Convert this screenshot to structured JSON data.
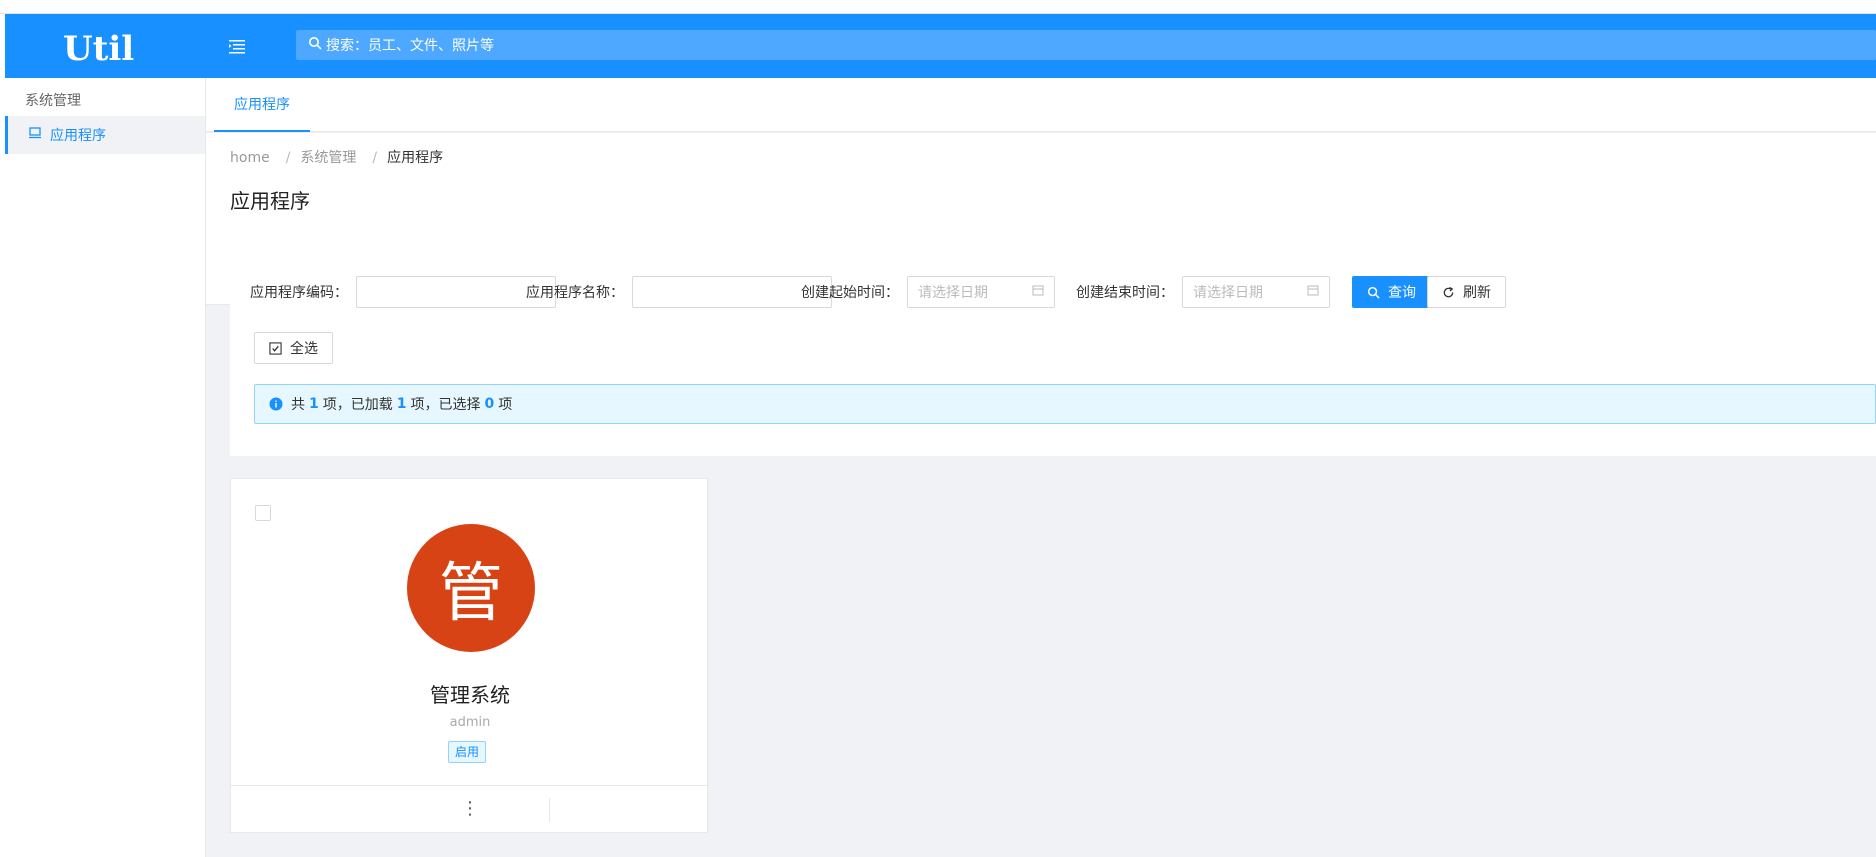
{
  "header": {
    "logo_text": "Util",
    "search_label": "搜索：员工、文件、照片等"
  },
  "sidebar": {
    "group_label": "系统管理",
    "items": [
      {
        "label": "应用程序",
        "icon": "laptop-icon"
      }
    ]
  },
  "tabs": [
    {
      "label": "应用程序"
    }
  ],
  "breadcrumb": [
    "home",
    "系统管理",
    "应用程序"
  ],
  "page_title": "应用程序",
  "filter": {
    "code_label": "应用程序编码：",
    "name_label": "应用程序名称：",
    "start_label": "创建起始时间：",
    "end_label": "创建结束时间：",
    "date_placeholder": "请选择日期",
    "query_label": "查询",
    "refresh_label": "刷新",
    "select_all_label": "全选"
  },
  "summary": {
    "prefix": "共",
    "total": "1",
    "mid1": "项，已加载",
    "loaded": "1",
    "mid2": "项，已选择",
    "selected": "0",
    "suffix": "项"
  },
  "cards": [
    {
      "avatar_char": "管",
      "name": "管理系统",
      "sub": "admin",
      "status": "启用"
    }
  ],
  "colors": {
    "primary": "#1890ff",
    "avatar_bg": "#d84315"
  }
}
